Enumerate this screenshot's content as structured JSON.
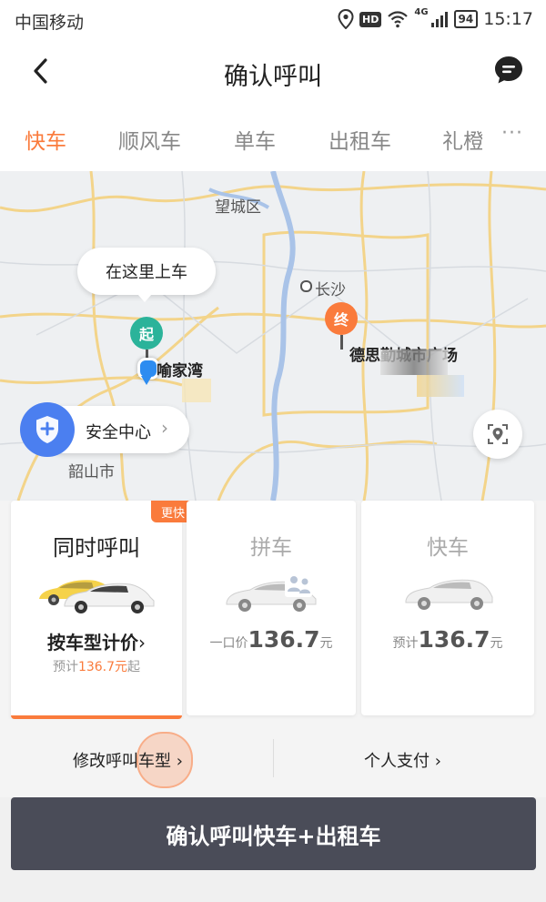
{
  "status_bar": {
    "carrier": "中国移动",
    "network": "4G",
    "hd": "HD",
    "battery": "94",
    "time": "15:17"
  },
  "header": {
    "title": "确认呼叫"
  },
  "tabs": [
    {
      "label": "快车",
      "active": true
    },
    {
      "label": "顺风车",
      "active": false
    },
    {
      "label": "单车",
      "active": false
    },
    {
      "label": "出租车",
      "active": false
    },
    {
      "label": "礼橙",
      "active": false
    }
  ],
  "tabs_more": "···",
  "map": {
    "pickup_bubble": "在这里上车",
    "start_pin": "起",
    "end_pin": "终",
    "labels": {
      "wangcheng": "望城区",
      "changsha": "长沙",
      "shaoshan": "韶山市",
      "yurongwan": "喻家湾",
      "deside": "德思勤城市广场"
    },
    "safety_center": "安全中心"
  },
  "cards": [
    {
      "badge": "更快",
      "title": "同时呼叫",
      "main": "按车型计价",
      "sub_prefix": "预计",
      "sub_amount": "136.7元",
      "sub_suffix": "起",
      "selected": true
    },
    {
      "title": "拼车",
      "price_prefix": "一口价",
      "price": "136.7",
      "price_unit": "元"
    },
    {
      "title": "快车",
      "price_prefix": "预计",
      "price": "136.7",
      "price_unit": "元"
    }
  ],
  "options": {
    "modify": "修改呼叫车型",
    "payment": "个人支付"
  },
  "confirm_button": "确认呼叫快车+出租车",
  "colors": {
    "accent": "#fa7b3c",
    "start_pin": "#2bb39a",
    "safety": "#4b7ff0",
    "confirm_bg": "#4a4c58"
  }
}
